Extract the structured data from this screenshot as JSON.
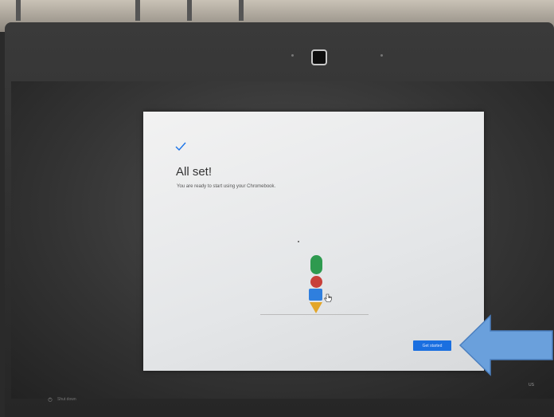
{
  "dialog": {
    "icon": "checkmark-icon",
    "title": "All set!",
    "subtitle": "You are ready to start using your Chromebook.",
    "button_label": "Get started",
    "accent_color": "#1a6fe0"
  },
  "illustration": {
    "colors": [
      "#2e9a4f",
      "#c8403a",
      "#2f7fde",
      "#e2a62a"
    ]
  },
  "shelf": {
    "left_label": "Shut down",
    "status_text": "US"
  },
  "annotation": {
    "icon": "arrow-left-icon",
    "color": "#6aa0dc"
  }
}
